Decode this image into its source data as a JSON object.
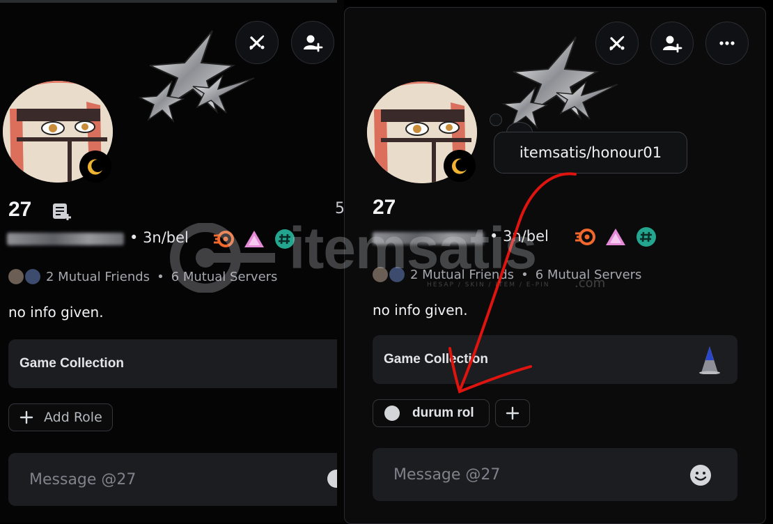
{
  "left_profile": {
    "display_name": "27",
    "pronouns": "3n/bel",
    "mutual_friends": "2 Mutual Friends",
    "mutual_servers": "6 Mutual Servers",
    "bio": "no info given.",
    "collection_label": "Game Collection",
    "add_role_label": "Add Role",
    "message_placeholder": "Message @27"
  },
  "right_profile": {
    "display_name": "27",
    "pronouns": "3n/bel",
    "mutual_friends": "2 Mutual Friends",
    "mutual_servers": "6 Mutual Servers",
    "bio": "no info given.",
    "collection_label": "Game Collection",
    "role_label": "durum rol",
    "message_placeholder": "Message @27",
    "tooltip": "itemsatis/honour01"
  },
  "side_digit": "5",
  "watermark": {
    "brand": "itemsatis",
    "tagline": "HESAP / SKIN / ITEM / E-PIN",
    "suffix": ".com"
  },
  "colors": {
    "background": "#000000",
    "panel": "#0b0b0c",
    "surface": "#1c1d21",
    "annotation_red": "#e0140f",
    "badge_orange": "#f0682c",
    "badge_pink": "#e58ad6",
    "badge_teal": "#23a58f"
  },
  "icons": [
    "block-icon",
    "add-friend-icon",
    "more-icon",
    "moon-icon",
    "plus-icon",
    "emoji-icon",
    "nitro-icon",
    "hypesquad-icon",
    "hashtag-icon"
  ]
}
